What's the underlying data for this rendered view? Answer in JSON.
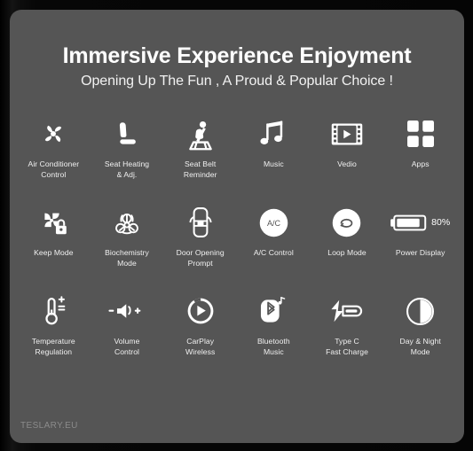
{
  "header": {
    "title": "Immersive Experience Enjoyment",
    "subtitle": "Opening Up The Fun , A Proud & Popular Choice !"
  },
  "colors": {
    "panel_background": "#555555",
    "page_background": "#060606",
    "icon": "#ffffff",
    "label_text": "#f0f0f0",
    "watermark": "#8b8b8b"
  },
  "features": [
    {
      "icon": "fan-icon",
      "label": "Air Conditioner\nControl"
    },
    {
      "icon": "car-seat-icon",
      "label": "Seat Heating\n& Adj."
    },
    {
      "icon": "seat-belt-icon",
      "label": "Seat Belt\nReminder"
    },
    {
      "icon": "music-note-icon",
      "label": "Music"
    },
    {
      "icon": "film-play-icon",
      "label": "Vedio"
    },
    {
      "icon": "apps-grid-icon",
      "label": "Apps"
    },
    {
      "icon": "fan-lock-icon",
      "label": "Keep Mode"
    },
    {
      "icon": "biohazard-icon",
      "label": "Biochemistry\nMode"
    },
    {
      "icon": "car-doors-open-icon",
      "label": "Door Opening\nPrompt"
    },
    {
      "icon": "ac-circle-icon",
      "label": "A/C Control",
      "glyph_text": "A/C"
    },
    {
      "icon": "recirculation-circle-icon",
      "label": "Loop Mode"
    },
    {
      "icon": "battery-icon",
      "label": "Power Display",
      "battery_percent": "80%"
    },
    {
      "icon": "thermometer-plus-minus-icon",
      "label": "Temperature\nRegulation"
    },
    {
      "icon": "volume-speaker-icon",
      "label": "Volume\nControl",
      "minus": "–",
      "plus": "+"
    },
    {
      "icon": "carplay-icon",
      "label": "CarPlay\nWireless"
    },
    {
      "icon": "bluetooth-music-icon",
      "label": "Bluetooth\nMusic"
    },
    {
      "icon": "usb-c-lightning-icon",
      "label": "Type C\nFast Charge"
    },
    {
      "icon": "day-night-contrast-icon",
      "label": "Day & Night\nMode"
    }
  ],
  "watermark": "TESLARY.EU"
}
